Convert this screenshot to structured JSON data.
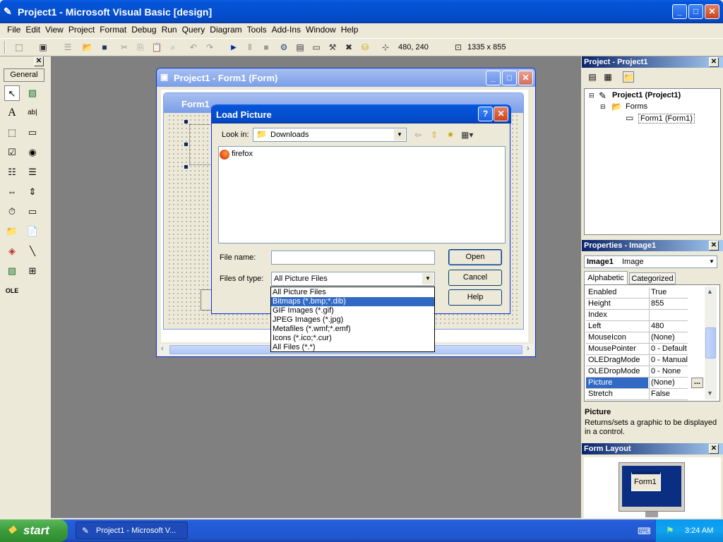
{
  "main_window": {
    "title": "Project1 - Microsoft Visual Basic [design]"
  },
  "menu": [
    "File",
    "Edit",
    "View",
    "Project",
    "Format",
    "Debug",
    "Run",
    "Query",
    "Diagram",
    "Tools",
    "Add-Ins",
    "Window",
    "Help"
  ],
  "toolbar": {
    "position": "480, 240",
    "size": "1335 x 855"
  },
  "toolbox": {
    "tab": "General"
  },
  "form_window": {
    "title": "Project1 - Form1 (Form)"
  },
  "form": {
    "title": "Form1"
  },
  "dialog": {
    "title": "Load Picture",
    "look_in_label": "Look in:",
    "look_in_value": "Downloads",
    "files": [
      "firefox"
    ],
    "file_name_label": "File name:",
    "file_name_value": "",
    "files_of_type_label": "Files of type:",
    "files_of_type_value": "All Picture Files",
    "type_options": [
      "All Picture Files",
      "Bitmaps (*.bmp;*.dib)",
      "GIF Images (*.gif)",
      "JPEG Images (*.jpg)",
      "Metafiles (*.wmf;*.emf)",
      "Icons (*.ico;*.cur)",
      "All Files (*.*)"
    ],
    "open_button": "Open",
    "cancel_button": "Cancel",
    "help_button": "Help"
  },
  "project_panel": {
    "title": "Project - Project1",
    "root": "Project1 (Project1)",
    "folder": "Forms",
    "item": "Form1 (Form1)"
  },
  "properties_panel": {
    "title": "Properties - Image1",
    "object_name": "Image1",
    "object_type": "Image",
    "tab_alphabetic": "Alphabetic",
    "tab_categorized": "Categorized",
    "rows": [
      {
        "name": "Enabled",
        "value": "True"
      },
      {
        "name": "Height",
        "value": "855"
      },
      {
        "name": "Index",
        "value": ""
      },
      {
        "name": "Left",
        "value": "480"
      },
      {
        "name": "MouseIcon",
        "value": "(None)"
      },
      {
        "name": "MousePointer",
        "value": "0 - Default"
      },
      {
        "name": "OLEDragMode",
        "value": "0 - Manual"
      },
      {
        "name": "OLEDropMode",
        "value": "0 - None"
      },
      {
        "name": "Picture",
        "value": "(None)"
      },
      {
        "name": "Stretch",
        "value": "False"
      }
    ],
    "desc_title": "Picture",
    "desc_text": "Returns/sets a graphic to be displayed in a control."
  },
  "form_layout": {
    "title": "Form Layout",
    "form_label": "Form1"
  },
  "taskbar": {
    "start": "start",
    "task": "Project1 - Microsoft V...",
    "clock": "3:24 AM"
  }
}
